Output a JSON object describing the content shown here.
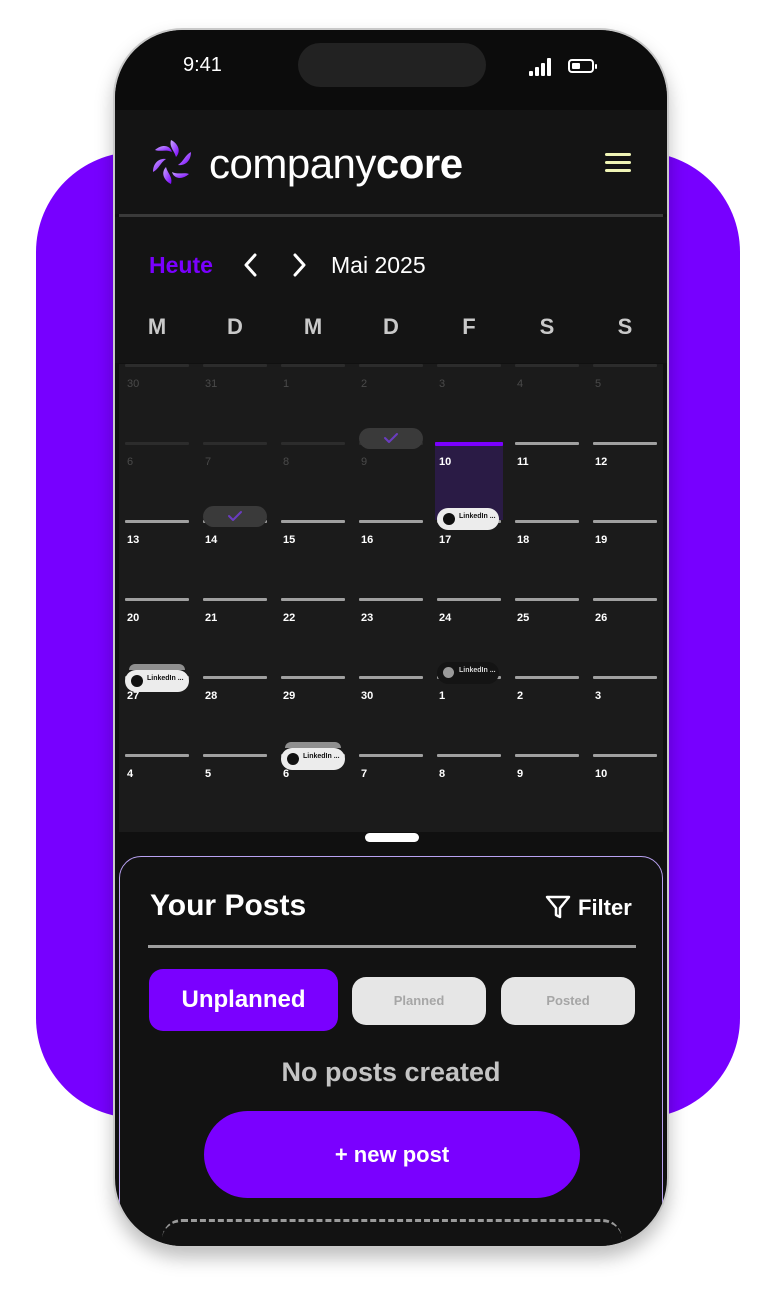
{
  "status_bar": {
    "time": "9:41"
  },
  "header": {
    "brand_light": "company",
    "brand_bold": "core"
  },
  "calendar": {
    "today_label": "Heute",
    "month_label": "Mai 2025",
    "weekdays": [
      "M",
      "D",
      "M",
      "D",
      "F",
      "S",
      "S"
    ],
    "weeks": [
      [
        "30",
        "31",
        "1",
        "2",
        "3",
        "4",
        "5"
      ],
      [
        "6",
        "7",
        "8",
        "9",
        "10",
        "11",
        "12"
      ],
      [
        "13",
        "14",
        "15",
        "16",
        "17",
        "18",
        "19"
      ],
      [
        "20",
        "21",
        "22",
        "23",
        "24",
        "25",
        "26"
      ],
      [
        "27",
        "28",
        "29",
        "30",
        "1",
        "2",
        "3"
      ],
      [
        "4",
        "5",
        "6",
        "7",
        "8",
        "9",
        "10"
      ]
    ],
    "today": "10",
    "post_chip_label": "LinkedIn ..."
  },
  "posts": {
    "title": "Your Posts",
    "filter_label": "Filter",
    "tabs": [
      "Unplanned",
      "Planned",
      "Posted"
    ],
    "active_tab": "Unplanned",
    "empty_text": "No posts created",
    "new_post_label": "+ new post"
  },
  "colors": {
    "accent": "#7a00ff",
    "background": "#101010",
    "menu_icon": "#f0f5b6"
  }
}
